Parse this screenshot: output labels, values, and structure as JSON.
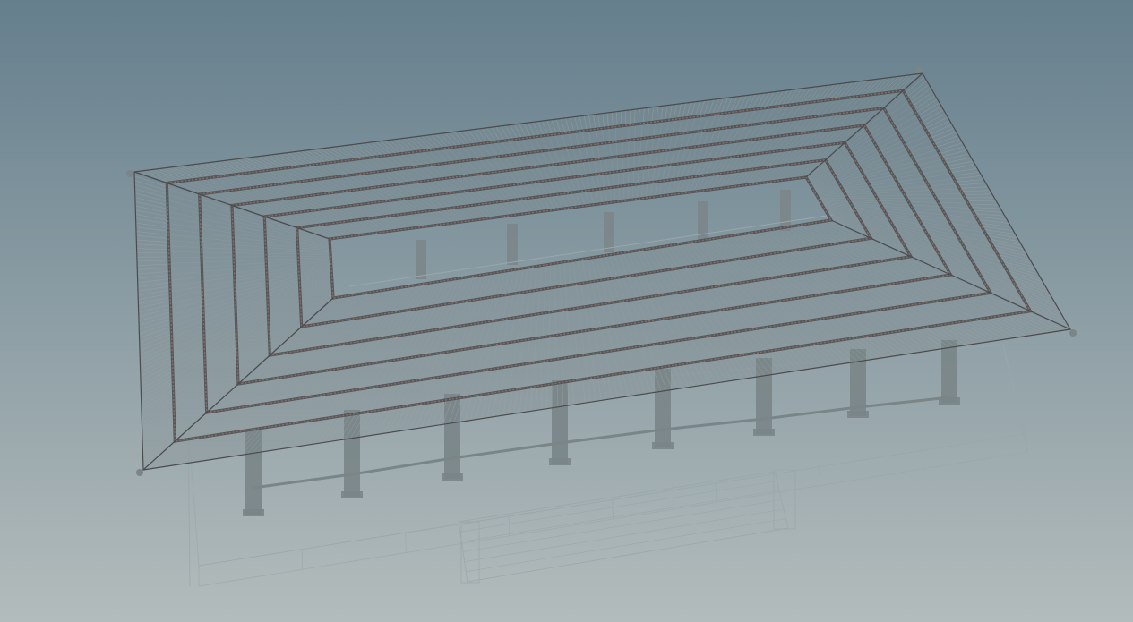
{
  "viewport": {
    "kind": "3d-wireframe-viewport",
    "subject": "pavilion-roof-wireframe",
    "background_top": "#657f8d",
    "background_bottom": "#b3bcbc",
    "geometry_color": "#7a8588",
    "dark_line_color": "#4b4b4e",
    "accent_line_color": "#8a6f68",
    "light_line_color": "#9aa7aa",
    "ring_count": 6,
    "column_count": 9,
    "icons": [
      "wireframe-roof-icon"
    ]
  }
}
